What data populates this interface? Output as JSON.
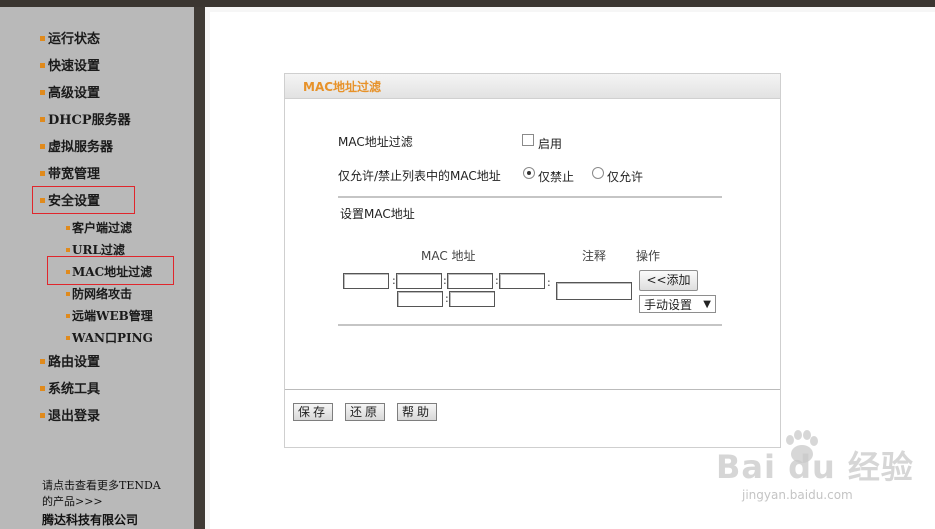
{
  "sidebar": {
    "items": [
      {
        "label": "运行状态"
      },
      {
        "label": "快速设置"
      },
      {
        "label": "高级设置"
      },
      {
        "label": "DHCP服务器"
      },
      {
        "label": "虚拟服务器"
      },
      {
        "label": "带宽管理"
      },
      {
        "label": "安全设置"
      }
    ],
    "subitems": [
      {
        "label": "客户端过滤"
      },
      {
        "label": "URL过滤"
      },
      {
        "label": "MAC地址过滤"
      },
      {
        "label": "防网络攻击"
      },
      {
        "label": "远端WEB管理"
      },
      {
        "label": "WAN口PING"
      }
    ],
    "items_after": [
      {
        "label": "路由设置"
      },
      {
        "label": "系统工具"
      },
      {
        "label": "退出登录"
      }
    ],
    "footer": {
      "line1": "请点击查看更多TENDA",
      "line2": "的产品>>>",
      "company": "腾达科技有限公司"
    }
  },
  "panel": {
    "title": "MAC地址过滤",
    "filter_label": "MAC地址过滤",
    "enable_label": "启用",
    "mode_label": "仅允许/禁止列表中的MAC地址",
    "deny_label": "仅禁止",
    "allow_label": "仅允许",
    "mode_selected": "仅禁止",
    "set_mac_label": "设置MAC地址",
    "col_mac": "MAC 地址",
    "col_note": "注释",
    "col_action": "操作",
    "add_button": "<<添加",
    "select_value": "手动设置",
    "buttons": {
      "save": "保存",
      "restore": "还原",
      "help": "帮助"
    }
  },
  "watermark": {
    "brand": "Bai du 经验",
    "url": "jingyan.baidu.com"
  },
  "colors": {
    "accent": "#e7922a",
    "bullet": "#e08a1c",
    "highlight": "#e0262c",
    "sidebar": "#b9b9b9"
  }
}
